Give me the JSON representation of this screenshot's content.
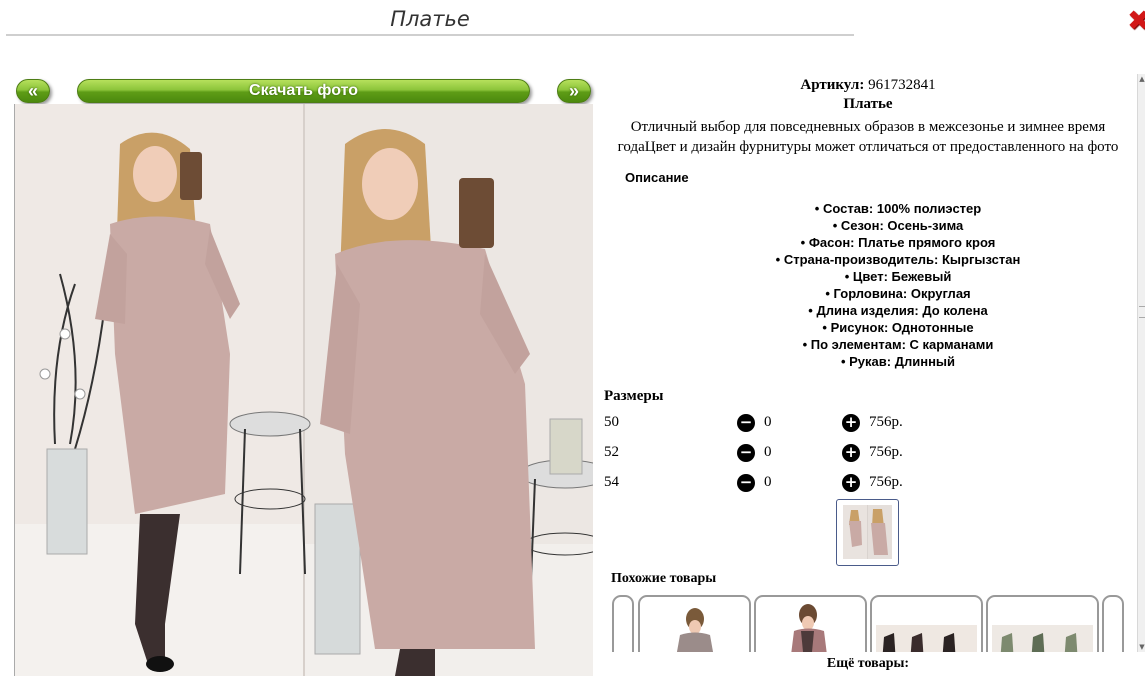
{
  "header": {
    "title": "Платье",
    "close_icon": "close-icon"
  },
  "gallery": {
    "prev_label": "«",
    "download_label": "Скачать фото",
    "next_label": "»"
  },
  "product": {
    "article_label": "Артикул:",
    "article_value": "961732841",
    "name": "Платье",
    "description_line1": "Отличный выбор для повседневных образов в межсезонье и зимнее время",
    "description_line2": "годаЦвет и дизайн фурнитуры может отличаться от предоставленного на фото",
    "description_heading": "Описание",
    "attributes": [
      "Состав: 100% полиэстер",
      "Сезон: Осень-зима",
      "Фасон: Платье прямого кроя",
      "Страна-производитель: Кыргызстан",
      "Цвет: Бежевый",
      "Горловина: Округлая",
      "Длина изделия: До колена",
      "Рисунок: Однотонные",
      "По элементам: С карманами",
      "Рукав: Длинный"
    ]
  },
  "sizes": {
    "heading": "Размеры",
    "rows": [
      {
        "size": "50",
        "qty": "0",
        "price": "756р."
      },
      {
        "size": "52",
        "qty": "0",
        "price": "756р."
      },
      {
        "size": "54",
        "qty": "0",
        "price": "756р."
      }
    ]
  },
  "similar": {
    "heading": "Похожие товары"
  },
  "more": {
    "heading": "Ещё товары:"
  },
  "colors": {
    "accent_green": "#8cc43a",
    "close_red": "#d21717",
    "dress_pink": "#c9aaa5"
  }
}
